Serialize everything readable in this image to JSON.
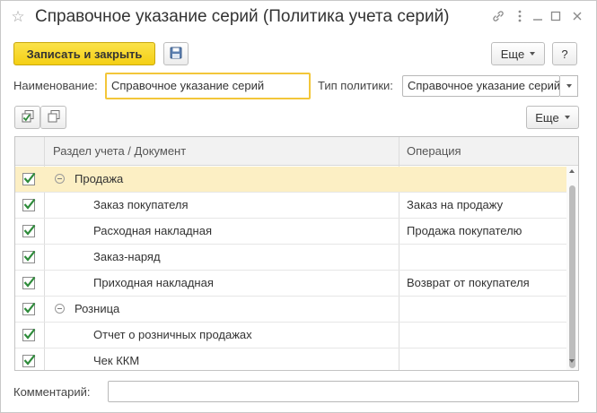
{
  "window": {
    "title": "Справочное указание серий (Политика учета серий)",
    "icons": [
      "star-icon",
      "link-icon",
      "more-icon",
      "minimize-icon",
      "maximize-icon",
      "close-icon"
    ]
  },
  "toolbar": {
    "save_close_label": "Записать и закрыть",
    "more_label": "Еще",
    "help_label": "?"
  },
  "form": {
    "name_label": "Наименование:",
    "name_value": "Справочное указание серий",
    "policy_type_label": "Тип политики:",
    "policy_type_value": "Справочное указание серий",
    "comment_label": "Комментарий:",
    "comment_value": ""
  },
  "table_toolbar": {
    "more_label": "Еще"
  },
  "table": {
    "columns": [
      "Раздел учета / Документ",
      "Операция"
    ],
    "rows": [
      {
        "checked": true,
        "group": true,
        "document": "Продажа",
        "operation": ""
      },
      {
        "checked": true,
        "group": false,
        "document": "Заказ покупателя",
        "operation": "Заказ на продажу"
      },
      {
        "checked": true,
        "group": false,
        "document": "Расходная накладная",
        "operation": "Продажа покупателю"
      },
      {
        "checked": true,
        "group": false,
        "document": "Заказ-наряд",
        "operation": ""
      },
      {
        "checked": true,
        "group": false,
        "document": "Приходная накладная",
        "operation": "Возврат от покупателя"
      },
      {
        "checked": true,
        "group": true,
        "document": "Розница",
        "operation": ""
      },
      {
        "checked": true,
        "group": false,
        "document": "Отчет о розничных продажах",
        "operation": ""
      },
      {
        "checked": true,
        "group": false,
        "document": "Чек ККМ",
        "operation": ""
      }
    ]
  },
  "colors": {
    "primary_button": "#f4cf14",
    "selected_row": "#fcefc4",
    "active_field_border": "#f3c63a",
    "checkmark": "#2e8b3a"
  }
}
